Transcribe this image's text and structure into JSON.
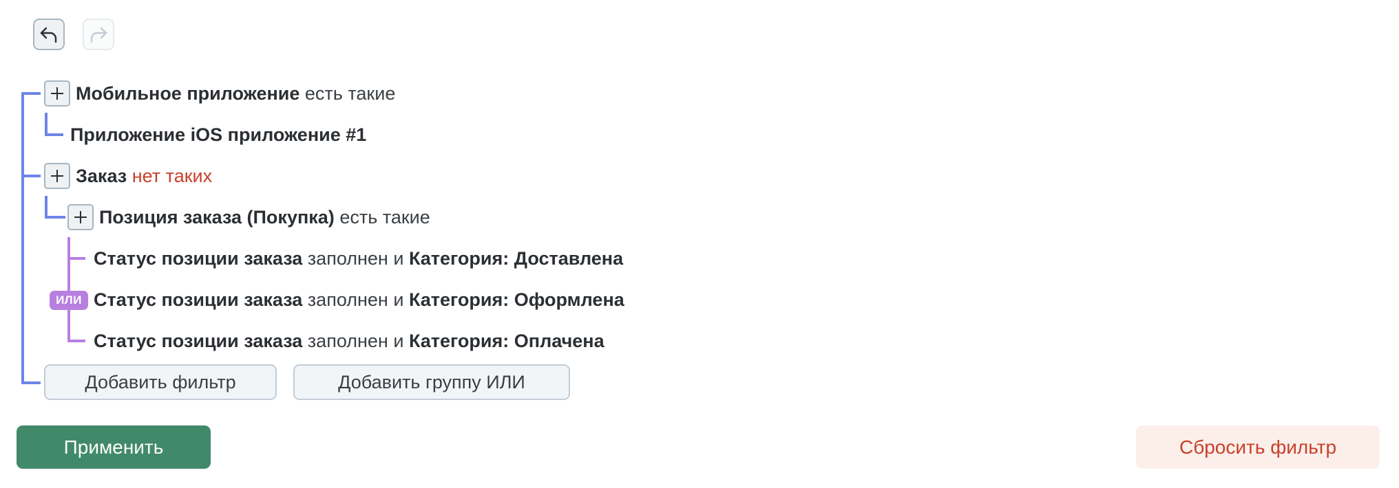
{
  "history": {
    "undo_icon": "undo-arrow-icon",
    "redo_icon": "redo-arrow-icon"
  },
  "filters": {
    "mobile_app": {
      "name": "Мобильное приложение",
      "condition": "есть такие"
    },
    "app_item": {
      "field": "Приложение",
      "value": "iOS приложение #1"
    },
    "order": {
      "name": "Заказ",
      "condition": "нет таких"
    },
    "order_item": {
      "name": "Позиция заказа (Покупка)",
      "condition": "есть такие"
    },
    "or_label": "ИЛИ",
    "status_rows": [
      {
        "field": "Статус позиции заказа",
        "state": "заполнен",
        "conj": "и",
        "cat_label": "Категория:",
        "cat_value": "Доставлена"
      },
      {
        "field": "Статус позиции заказа",
        "state": "заполнен",
        "conj": "и",
        "cat_label": "Категория:",
        "cat_value": "Оформлена"
      },
      {
        "field": "Статус позиции заказа",
        "state": "заполнен",
        "conj": "и",
        "cat_label": "Категория:",
        "cat_value": "Оплачена"
      }
    ]
  },
  "actions": {
    "add_filter": "Добавить фильтр",
    "add_or_group": "Добавить группу ИЛИ",
    "apply": "Применить",
    "reset": "Сбросить фильтр"
  },
  "colors": {
    "tree_line": "#6d85e6",
    "or_group": "#b77fe0",
    "negation": "#c8402a",
    "apply_bg": "#418a69",
    "reset_text": "#c8402a"
  }
}
